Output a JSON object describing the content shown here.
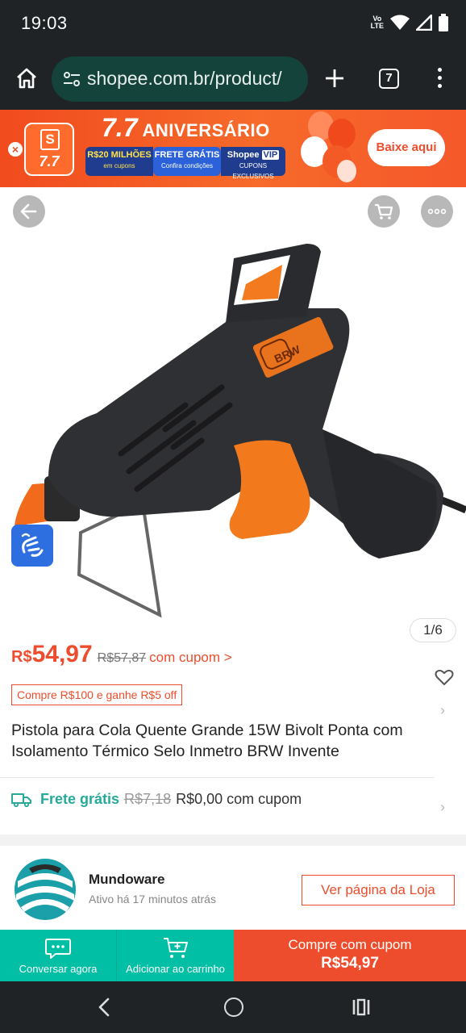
{
  "status_bar": {
    "time": "19:03",
    "network": "LTE",
    "icons": [
      "volte-icon",
      "wifi-icon",
      "signal-icon",
      "battery-icon"
    ]
  },
  "browser": {
    "url": "shopee.com.br/product/",
    "tab_count": "7"
  },
  "promo_banner": {
    "bag_label": "7.7",
    "title_number": "7.7",
    "title_text": "ANIVERSÁRIO",
    "tags": [
      {
        "main": "R$20 MILHÕES",
        "sub": "em cupons"
      },
      {
        "main": "FRETE GRÁTIS",
        "sub": "Confira condições"
      },
      {
        "main": "Shopee",
        "badge": "VIP",
        "sub": "CUPONS EXCLUSIVOS"
      }
    ],
    "cta": "Baixe aqui"
  },
  "product": {
    "image_counter": "1/6",
    "currency": "R$",
    "price": "54,97",
    "old_price": "R$57,87",
    "coupon_link": "com cupom >",
    "promo_chip": "Compre R$100 e ganhe R$5 off",
    "title": "Pistola para Cola Quente Grande 15W Bivolt Ponta com Isolamento Térmico Selo Inmetro BRW Invente",
    "brand_label_on_image": "BRW"
  },
  "shipping": {
    "label": "Frete grátis",
    "old_price": "R$7,18",
    "new_price": "R$0,00 com cupom"
  },
  "shop": {
    "name": "Mundoware",
    "status": "Ativo há 17 minutos atrás",
    "button": "Ver página da Loja"
  },
  "action_bar": {
    "chat": "Conversar agora",
    "add_to_cart": "Adicionar ao carrinho",
    "buy_label": "Compre com cupom",
    "buy_price": "R$54,97"
  },
  "colors": {
    "shopee_orange": "#ee4d2d",
    "teal": "#00bfa5",
    "shipping_teal": "#26aa99",
    "browser_dark": "#1f2325",
    "url_box": "#14433c"
  }
}
